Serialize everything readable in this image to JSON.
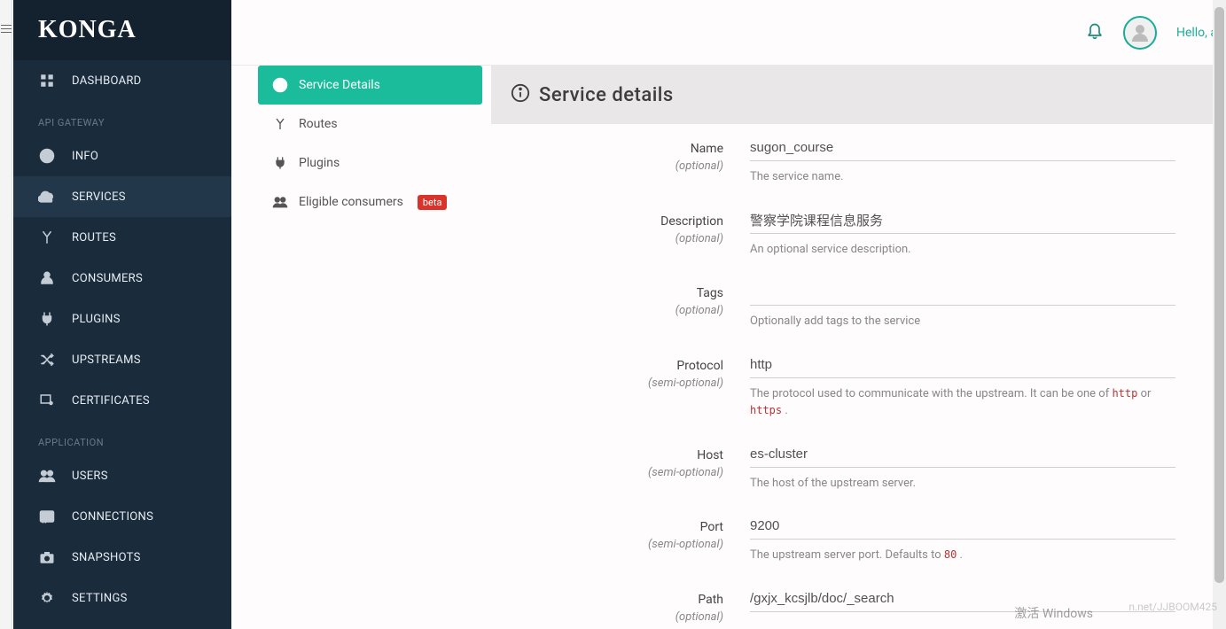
{
  "brand": "KONGA",
  "header": {
    "greeting": "Hello, a"
  },
  "sidebar": {
    "dashboard": "DASHBOARD",
    "sections": {
      "api_gateway": "API GATEWAY",
      "application": "APPLICATION"
    },
    "items": {
      "info": "INFO",
      "services": "SERVICES",
      "routes": "ROUTES",
      "consumers": "CONSUMERS",
      "plugins": "PLUGINS",
      "upstreams": "UPSTREAMS",
      "certificates": "CERTIFICATES",
      "users": "USERS",
      "connections": "CONNECTIONS",
      "snapshots": "SNAPSHOTS",
      "settings": "SETTINGS"
    }
  },
  "subnav": {
    "service_details": "Service Details",
    "routes": "Routes",
    "plugins": "Plugins",
    "eligible_consumers": "Eligible consumers",
    "beta_badge": "beta"
  },
  "panel": {
    "title": "Service details"
  },
  "form": {
    "name": {
      "label": "Name",
      "hint": "(optional)",
      "value": "sugon_course",
      "help": "The service name."
    },
    "description": {
      "label": "Description",
      "hint": "(optional)",
      "value": "警察学院课程信息服务",
      "help": "An optional service description."
    },
    "tags": {
      "label": "Tags",
      "hint": "(optional)",
      "value": "",
      "help": "Optionally add tags to the service"
    },
    "protocol": {
      "label": "Protocol",
      "hint": "(semi-optional)",
      "value": "http",
      "help_pre": "The protocol used to communicate with the upstream. It can be one of ",
      "help_code1": "http",
      "help_mid": " or ",
      "help_code2": "https",
      "help_post": " ."
    },
    "host": {
      "label": "Host",
      "hint": "(semi-optional)",
      "value": "es-cluster",
      "help": "The host of the upstream server."
    },
    "port": {
      "label": "Port",
      "hint": "(semi-optional)",
      "value": "9200",
      "help_pre": "The upstream server port. Defaults to ",
      "help_code": "80",
      "help_post": " ."
    },
    "path": {
      "label": "Path",
      "hint": "(optional)",
      "value": "/gxjx_kcsjlb/doc/_search"
    }
  },
  "watermarks": {
    "windows": "激活 Windows",
    "csdn": "n.net/JJBOOM425"
  }
}
